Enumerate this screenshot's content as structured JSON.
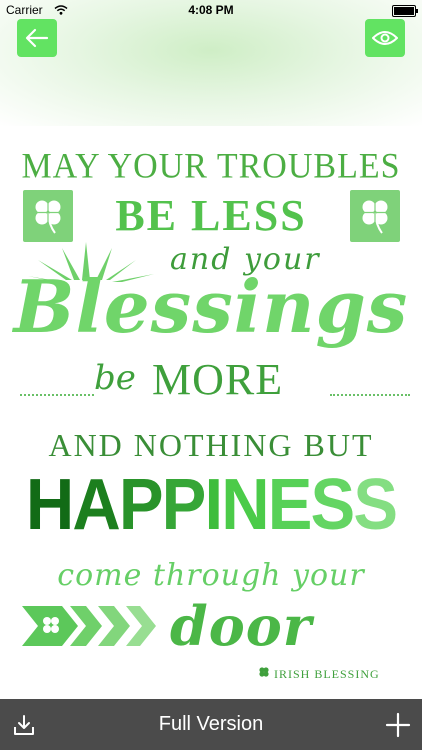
{
  "status_bar": {
    "carrier": "Carrier",
    "time": "4:08 PM"
  },
  "header": {
    "back_icon": "arrow-left-icon",
    "view_icon": "eye-icon",
    "accent_color": "#62e362"
  },
  "poster": {
    "line1": "MAY YOUR TROUBLES",
    "line2": "BE LESS",
    "line3": "and your",
    "line4": "Blessings",
    "line5a": "be",
    "line5b": "MORE",
    "line6": "AND NOTHING BUT",
    "line7_letters": [
      "H",
      "A",
      "P",
      "P",
      "I",
      "N",
      "E",
      "S",
      "S",
      ""
    ],
    "line8": "come through your",
    "line9": "door",
    "credit": "IRISH BLESSING"
  },
  "toolbar": {
    "download_icon": "download-icon",
    "label": "Full Version",
    "add_icon": "plus-icon",
    "background": "#4b4b4b"
  }
}
